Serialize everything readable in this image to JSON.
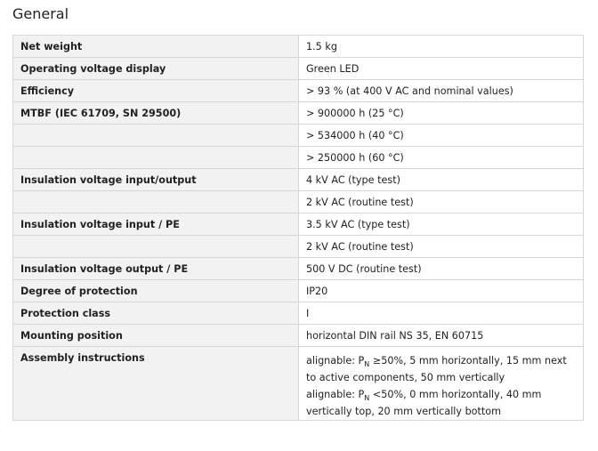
{
  "section_title": "General",
  "rows": [
    {
      "label": "Net weight",
      "value": "1.5 kg"
    },
    {
      "label": "Operating voltage display",
      "value": "Green LED"
    },
    {
      "label": "Efficiency",
      "value": "> 93 % (at 400 V AC and nominal values)"
    },
    {
      "label": "MTBF (IEC 61709, SN 29500)",
      "value": "> 900000 h (25 °C)"
    },
    {
      "label": "",
      "value": "> 534000 h (40 °C)"
    },
    {
      "label": "",
      "value": "> 250000 h (60 °C)"
    },
    {
      "label": "Insulation voltage input/output",
      "value": "4 kV AC (type test)"
    },
    {
      "label": "",
      "value": "2 kV AC (routine test)"
    },
    {
      "label": "Insulation voltage input / PE",
      "value": "3.5 kV AC (type test)"
    },
    {
      "label": "",
      "value": "2 kV AC (routine test)"
    },
    {
      "label": "Insulation voltage output / PE",
      "value": "500 V DC (routine test)"
    },
    {
      "label": "Degree of protection",
      "value": "IP20"
    },
    {
      "label": "Protection class",
      "value": "I"
    },
    {
      "label": "Mounting position",
      "value": "horizontal DIN rail NS 35, EN 60715"
    }
  ],
  "assembly": {
    "label": "Assembly instructions",
    "line1_pre": "alignable: P",
    "line1_sub": "N",
    "line1_post": " ≥50%, 5 mm horizontally, 15 mm next",
    "line2": "to active components, 50 mm vertically",
    "line3_pre": "alignable: P",
    "line3_sub": "N",
    "line3_post": " <50%, 0 mm horizontally, 40 mm",
    "line4": "vertically top, 20 mm vertically bottom"
  }
}
